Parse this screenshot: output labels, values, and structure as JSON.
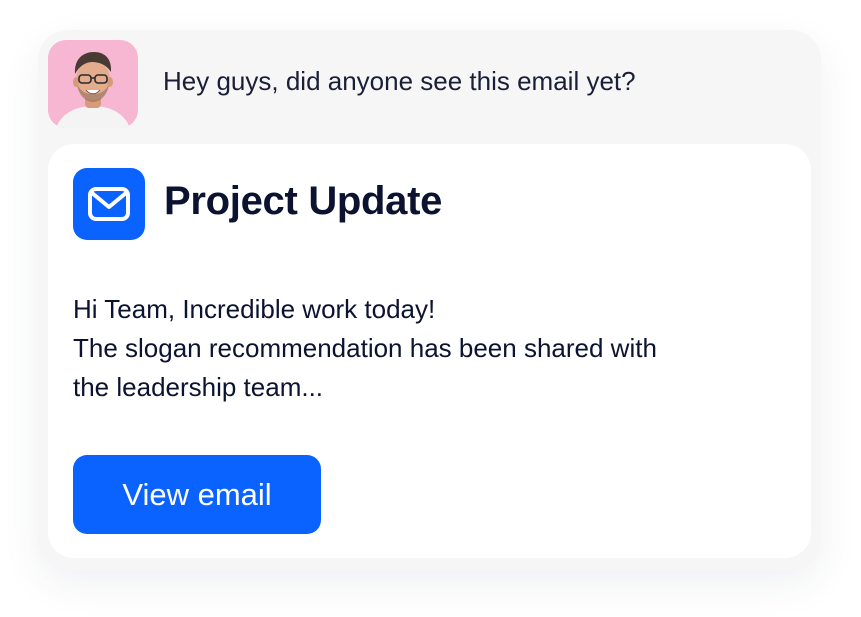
{
  "chat": {
    "message": "Hey guys, did anyone see this email yet?"
  },
  "card": {
    "icon": "mail-icon",
    "title": "Project Update",
    "body_lines": [
      "Hi Team, Incredible work today!",
      "The slogan recommendation has been shared with",
      "the leadership team..."
    ],
    "button_label": "View email"
  },
  "colors": {
    "accent": "#0a62ff",
    "avatar_bg": "#f7b7d2",
    "text": "#0b1330",
    "panel_bg": "#f6f6f7"
  }
}
